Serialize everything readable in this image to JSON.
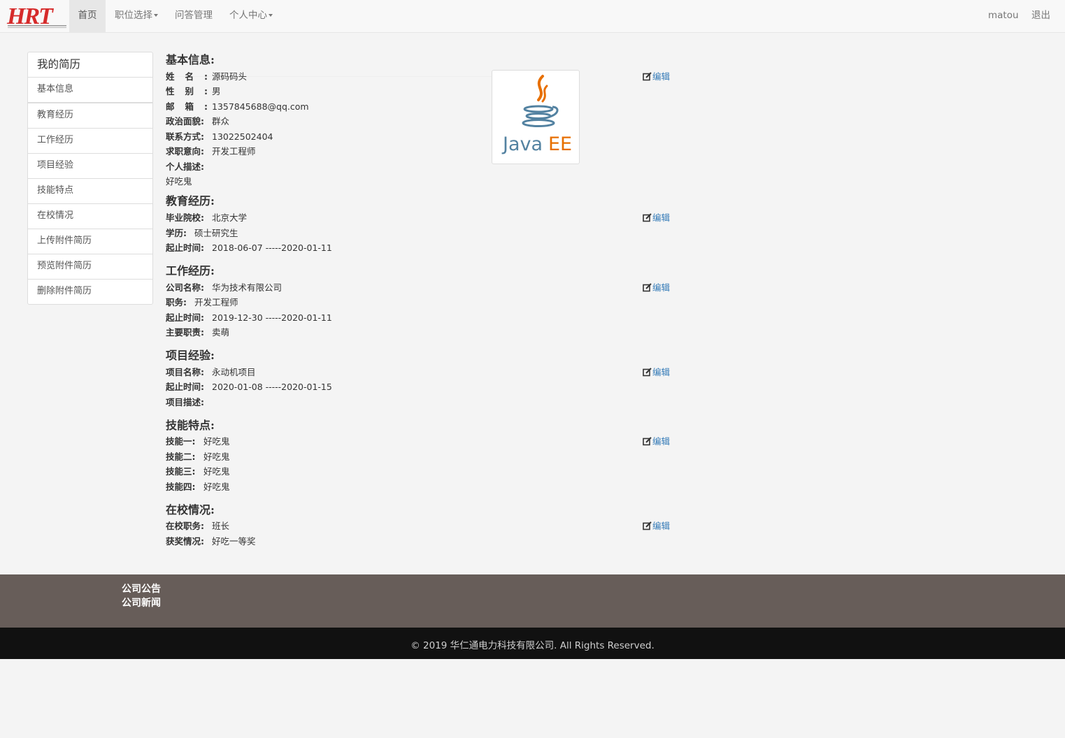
{
  "navbar": {
    "logo_text": "HRT",
    "items": [
      {
        "label": "首页"
      },
      {
        "label": "职位选择"
      },
      {
        "label": "问答管理"
      },
      {
        "label": "个人中心"
      }
    ],
    "user": "matou",
    "logout": "退出"
  },
  "sidebar": {
    "title": "我的简历",
    "items": [
      {
        "label": "基本信息"
      },
      {
        "label": "教育经历"
      },
      {
        "label": "工作经历"
      },
      {
        "label": "项目经验"
      },
      {
        "label": "技能特点"
      },
      {
        "label": "在校情况"
      },
      {
        "label": "上传附件简历"
      },
      {
        "label": "预览附件简历"
      },
      {
        "label": "删除附件简历"
      }
    ]
  },
  "edit_label": "编辑",
  "basic": {
    "title": "基本信息:",
    "name_label": "姓名:",
    "name": "源码码头",
    "gender_label": "性别:",
    "gender": "男",
    "email_label": "邮箱:",
    "email": "1357845688@qq.com",
    "politics_label": "政治面貌:",
    "politics": "群众",
    "phone_label": "联系方式:",
    "phone": "13022502404",
    "intent_label": "求职意向:",
    "intent": "开发工程师",
    "desc_label": "个人描述:",
    "desc": "好吃鬼",
    "avatar_text": "Java EE"
  },
  "education": {
    "title": "教育经历:",
    "school_label": "毕业院校:",
    "school": "北京大学",
    "degree_label": "学历:",
    "degree": "硕士研究生",
    "period_label": "起止时间:",
    "period": "2018-06-07 -----2020-01-11"
  },
  "work": {
    "title": "工作经历:",
    "company_label": "公司名称:",
    "company": "华为技术有限公司",
    "position_label": "职务:",
    "position": "开发工程师",
    "period_label": "起止时间:",
    "period": "2019-12-30 -----2020-01-11",
    "duty_label": "主要职责:",
    "duty": "卖萌"
  },
  "project": {
    "title": "项目经验:",
    "name_label": "项目名称:",
    "name": "永动机项目",
    "period_label": "起止时间:",
    "period": "2020-01-08 -----2020-01-15",
    "desc_label": "项目描述:",
    "desc": ""
  },
  "skills": {
    "title": "技能特点:",
    "items": [
      {
        "label": "技能一:",
        "value": "好吃鬼"
      },
      {
        "label": "技能二:",
        "value": "好吃鬼"
      },
      {
        "label": "技能三:",
        "value": "好吃鬼"
      },
      {
        "label": "技能四:",
        "value": "好吃鬼"
      }
    ]
  },
  "school": {
    "title": "在校情况:",
    "role_label": "在校职务:",
    "role": "班长",
    "award_label": "获奖情况:",
    "award": "好吃一等奖"
  },
  "footer": {
    "links": [
      {
        "label": "公司公告"
      },
      {
        "label": "公司新闻"
      }
    ],
    "copyright": "© 2019 华仁通电力科技有限公司. All Rights Reserved."
  },
  "colors": {
    "link": "#337ab7",
    "footer_top": "#675d59",
    "footer_bottom": "#111111",
    "java_blue": "#5382a1",
    "java_orange": "#e76f00"
  }
}
